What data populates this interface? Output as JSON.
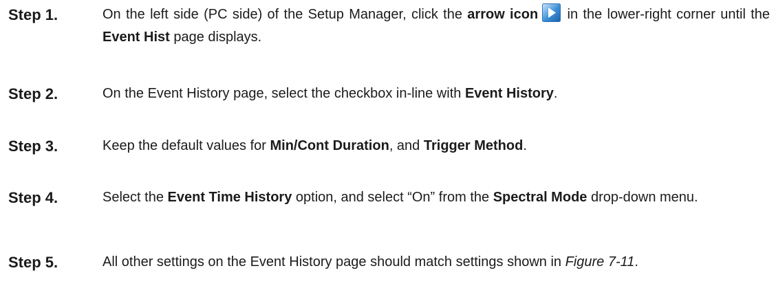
{
  "steps": [
    {
      "label": "Step 1.",
      "parts": [
        "On the left side (PC side) of the Setup Manager, click the ",
        "arrow icon",
        " in the lower-right corner until the ",
        "Event Hist",
        " page displays."
      ],
      "icon": "arrow-right-icon"
    },
    {
      "label": "Step 2.",
      "parts": [
        "On the Event History page, select the checkbox in-line with ",
        "Event History",
        "."
      ]
    },
    {
      "label": "Step 3.",
      "parts": [
        "Keep the default values for ",
        "Min/Cont Duration",
        ", and ",
        "Trigger Method",
        "."
      ]
    },
    {
      "label": "Step 4.",
      "parts": [
        "Select the ",
        "Event Time History",
        " option, and select “On” from the ",
        "Spectral Mode",
        " drop-down menu."
      ]
    },
    {
      "label": "Step 5.",
      "parts": [
        "All other settings on the Event History page should match settings shown in ",
        "Figure 7-11",
        "."
      ]
    }
  ],
  "colors": {
    "text": "#1b1b1b",
    "icon_blue": "#3a8fd6",
    "icon_light": "#b9dcf7"
  }
}
